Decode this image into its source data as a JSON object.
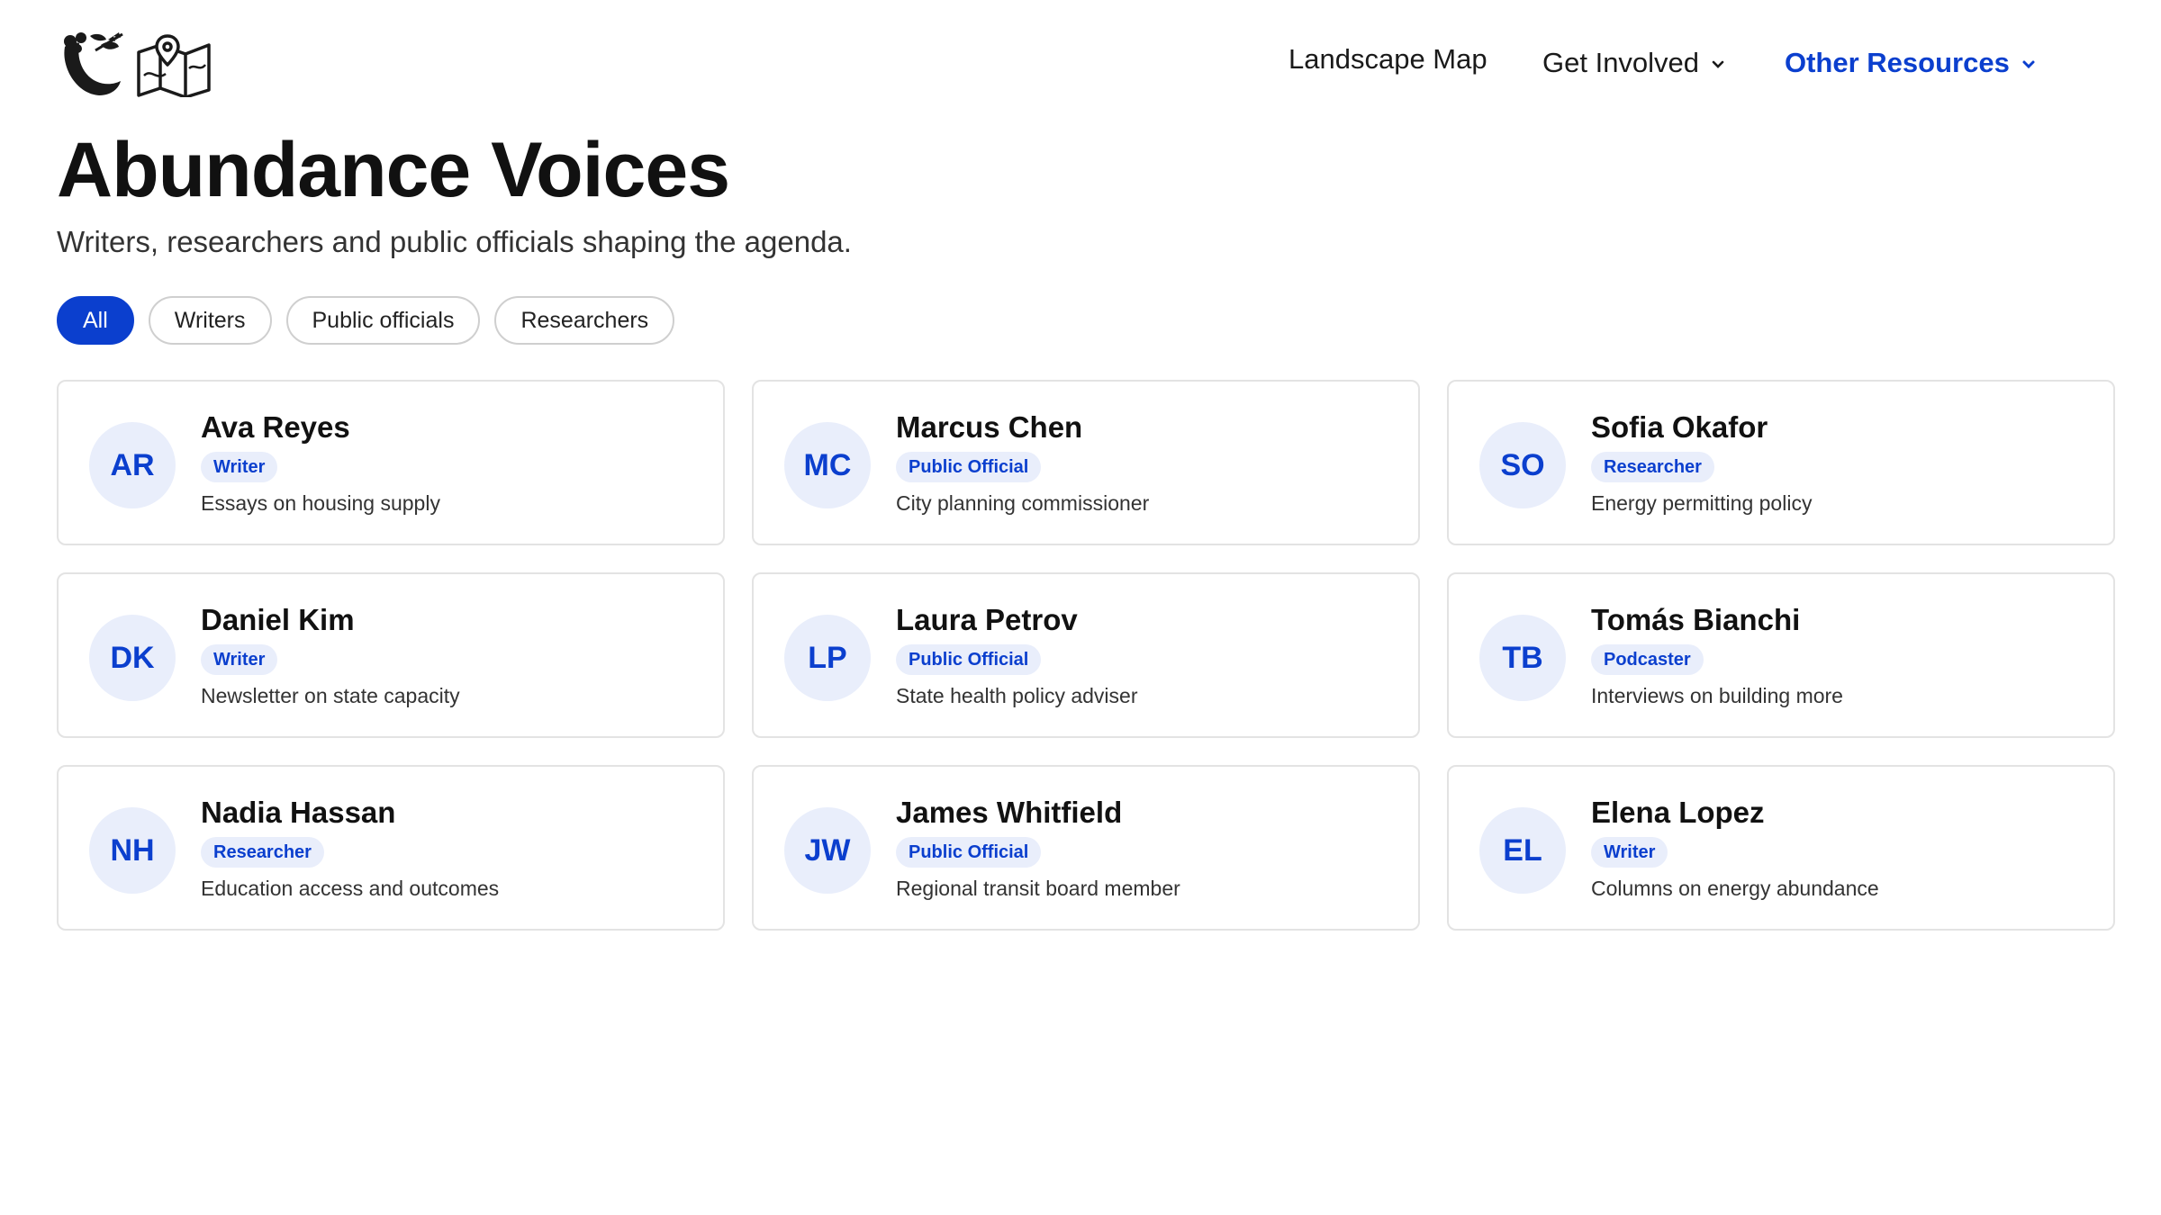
{
  "nav": {
    "items": [
      {
        "label": "Landscape Map",
        "has_chevron": false,
        "active": false
      },
      {
        "label": "Get Involved",
        "has_chevron": true,
        "active": false
      },
      {
        "label": "Other Resources",
        "has_chevron": true,
        "active": true
      }
    ]
  },
  "logo": {
    "icons": [
      "cornucopia-icon",
      "folded-map-icon"
    ]
  },
  "page": {
    "title": "Abundance Voices",
    "subtitle": "Writers, researchers and public officials shaping the agenda."
  },
  "filters": {
    "items": [
      "All",
      "Writers",
      "Public officials",
      "Researchers"
    ],
    "selected": "All"
  },
  "people": [
    {
      "initials": "AR",
      "name": "Ava Reyes",
      "role": "Writer",
      "desc": "Essays on housing supply"
    },
    {
      "initials": "MC",
      "name": "Marcus Chen",
      "role": "Public Official",
      "desc": "City planning commissioner"
    },
    {
      "initials": "SO",
      "name": "Sofia Okafor",
      "role": "Researcher",
      "desc": "Energy permitting policy"
    },
    {
      "initials": "DK",
      "name": "Daniel Kim",
      "role": "Writer",
      "desc": "Newsletter on state capacity"
    },
    {
      "initials": "LP",
      "name": "Laura Petrov",
      "role": "Public Official",
      "desc": "State health policy adviser"
    },
    {
      "initials": "TB",
      "name": "Tomás Bianchi",
      "role": "Podcaster",
      "desc": "Interviews on building more"
    },
    {
      "initials": "NH",
      "name": "Nadia Hassan",
      "role": "Researcher",
      "desc": "Education access and outcomes"
    },
    {
      "initials": "JW",
      "name": "James Whitfield",
      "role": "Public Official",
      "desc": "Regional transit board member"
    },
    {
      "initials": "EL",
      "name": "Elena Lopez",
      "role": "Writer",
      "desc": "Columns on energy abundance"
    }
  ],
  "colors": {
    "accent": "#0b3fce",
    "avatar_bg": "#e9eefb",
    "card_border": "#e3e3e3"
  }
}
